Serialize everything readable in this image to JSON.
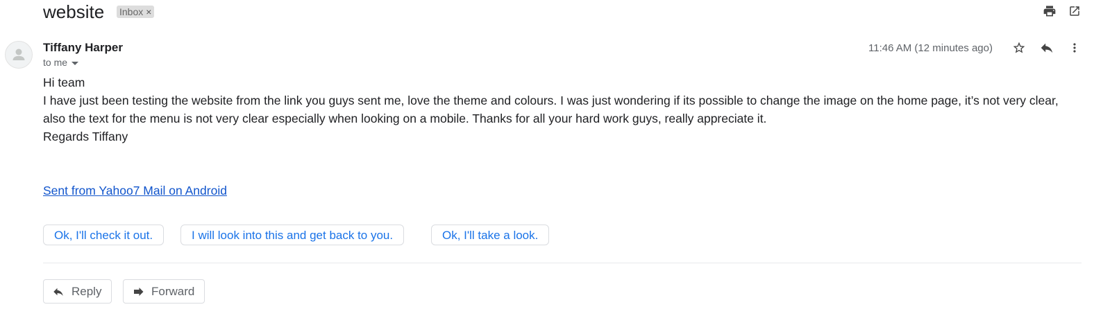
{
  "email": {
    "subject": "website",
    "label": "Inbox",
    "label_close": "×",
    "sender_name": "Tiffany Harper",
    "recipient": "to me",
    "timestamp": "11:46 AM (12 minutes ago)",
    "body": [
      "Hi team",
      "I have just been testing the website from the link you guys sent me, love the theme and colours. I was just wondering if its possible to change the image on the home page, it’s not very clear, also the text for the menu is not very clear especially when looking on a mobile. Thanks for all your hard work guys, really appreciate it.",
      "Regards Tiffany"
    ],
    "signature_link": "Sent from Yahoo7 Mail on Android"
  },
  "smart_replies": [
    "Ok, I'll check it out.",
    "I will look into this and get back to you.",
    "Ok, I'll take a look."
  ],
  "actions": {
    "reply": "Reply",
    "forward": "Forward"
  },
  "icons": {
    "print": "print-icon",
    "open_new_window": "open-in-new-window-icon",
    "star": "star-outline-icon",
    "reply": "reply-icon",
    "more": "more-vertical-icon",
    "avatar": "person-icon",
    "dropdown": "caret-down-icon",
    "forward": "forward-icon"
  },
  "colors": {
    "link": "#1155cc",
    "smart_reply_text": "#1a73e8",
    "label_chip_bg": "#dddddd"
  }
}
